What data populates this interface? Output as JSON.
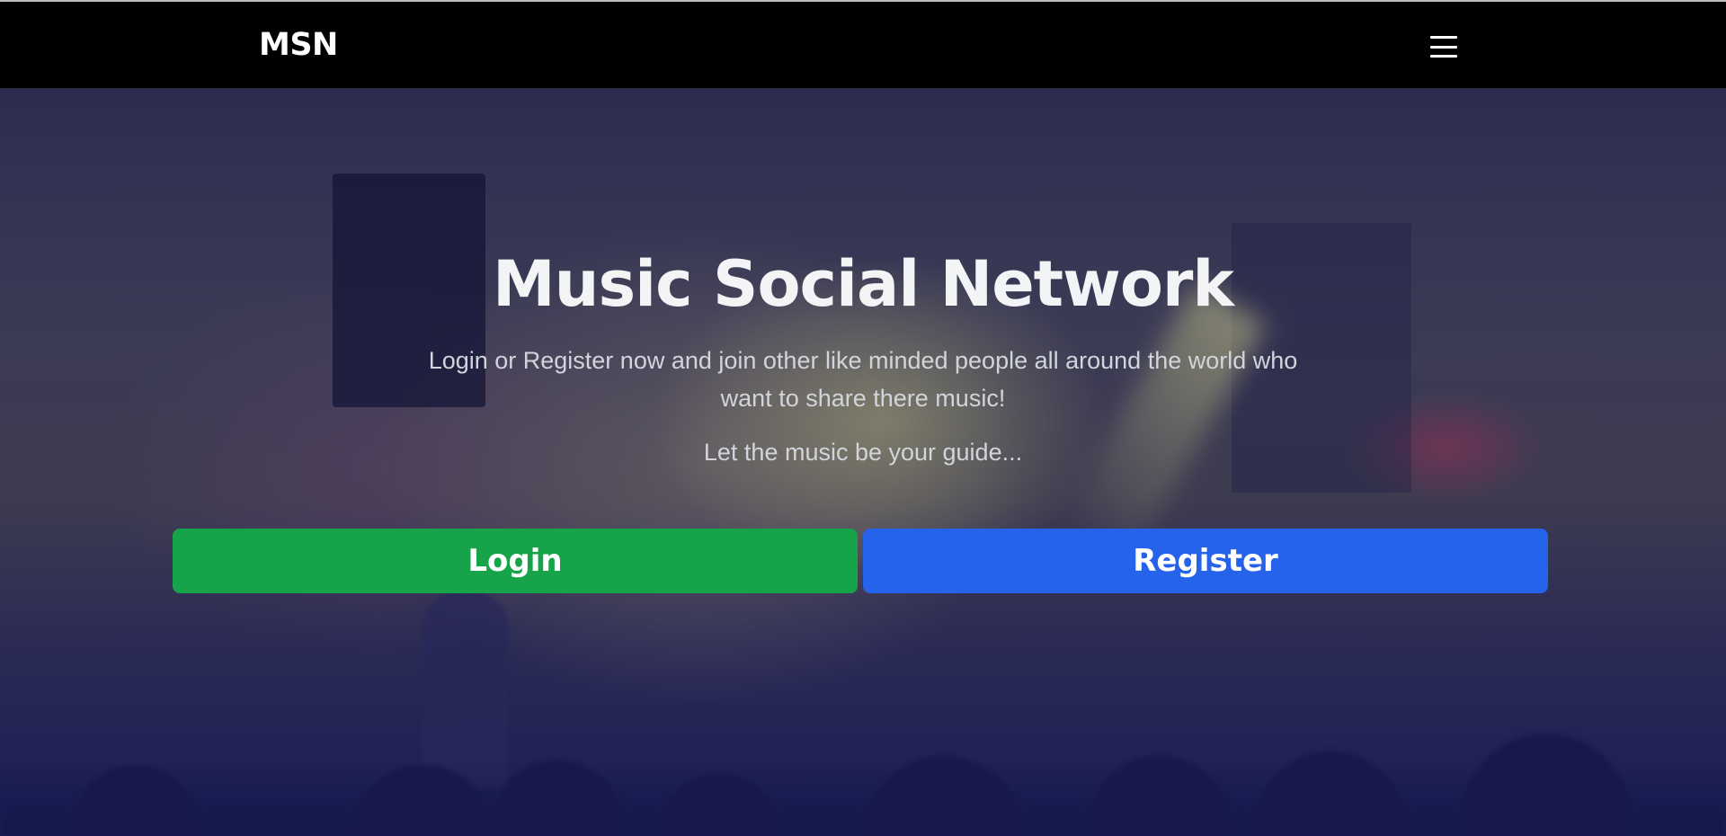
{
  "navbar": {
    "brand": "MSN",
    "menu_icon": "hamburger-menu-icon"
  },
  "hero": {
    "title": "Music Social Network",
    "subtitle": "Login or Register now and join other like minded people all around the world who want to share there music!",
    "tagline": "Let the music be your guide...",
    "login_label": "Login",
    "register_label": "Register"
  },
  "colors": {
    "navbar_bg": "#000000",
    "login_button": "#16a34a",
    "register_button": "#2563eb",
    "title_text": "#f3f4f6",
    "body_text": "#d1d5db"
  }
}
